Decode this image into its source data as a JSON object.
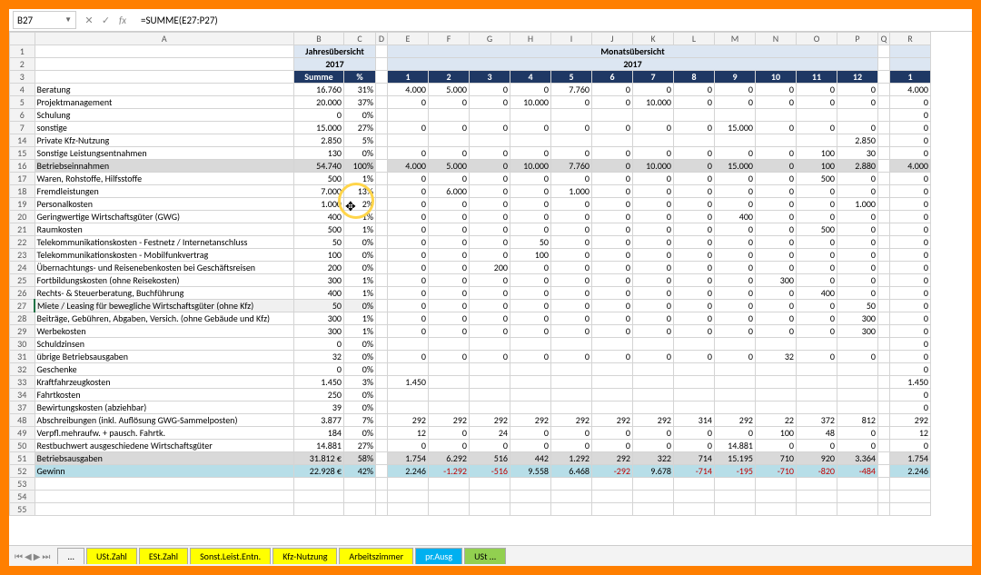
{
  "nameBox": "B27",
  "formula": "=SUMME(E27:P27)",
  "jahresHeader": "Jahresübersicht",
  "monatsHeader": "Monatsübersicht",
  "year": "2017",
  "sumLabel": "Summe",
  "pctLabel": "%",
  "colLetters": [
    "",
    "A",
    "B",
    "C",
    "D",
    "E",
    "F",
    "G",
    "H",
    "I",
    "J",
    "K",
    "L",
    "M",
    "N",
    "O",
    "P",
    "Q",
    "R"
  ],
  "months": [
    "1",
    "2",
    "3",
    "4",
    "5",
    "6",
    "7",
    "8",
    "9",
    "10",
    "11",
    "12"
  ],
  "rightStart": "1",
  "rows": [
    {
      "r": 4,
      "label": "Beratung",
      "b": "16.760",
      "c": "31%",
      "m": [
        "4.000",
        "5.000",
        "0",
        "0",
        "7.760",
        "0",
        "0",
        "0",
        "0",
        "0",
        "0",
        "0"
      ],
      "rr": "4.000"
    },
    {
      "r": 5,
      "label": "Projektmanagement",
      "b": "20.000",
      "c": "37%",
      "m": [
        "0",
        "0",
        "0",
        "10.000",
        "0",
        "0",
        "10.000",
        "0",
        "0",
        "0",
        "0",
        "0"
      ],
      "rr": "0"
    },
    {
      "r": 6,
      "label": "Schulung",
      "b": "0",
      "c": "0%",
      "m": [
        "",
        "",
        "",
        "",
        "",
        "",
        "",
        "",
        "",
        "",
        "",
        ""
      ],
      "rr": "0"
    },
    {
      "r": 7,
      "label": "sonstige",
      "b": "15.000",
      "c": "27%",
      "m": [
        "0",
        "0",
        "0",
        "0",
        "0",
        "0",
        "0",
        "0",
        "15.000",
        "0",
        "0",
        "0"
      ],
      "rr": "0"
    },
    {
      "r": 14,
      "label": "Private Kfz-Nutzung",
      "b": "2.850",
      "c": "5%",
      "m": [
        "",
        "",
        "",
        "",
        "",
        "",
        "",
        "",
        "",
        "",
        "",
        "2.850"
      ],
      "rr": "0"
    },
    {
      "r": 15,
      "label": "Sonstige Leistungsentnahmen",
      "b": "130",
      "c": "0%",
      "m": [
        "0",
        "0",
        "0",
        "0",
        "0",
        "0",
        "0",
        "0",
        "0",
        "0",
        "100",
        "30"
      ],
      "rr": "0"
    },
    {
      "r": 16,
      "label": "Betriebseinnahmen",
      "b": "54.740",
      "c": "100%",
      "m": [
        "4.000",
        "5.000",
        "0",
        "10.000",
        "7.760",
        "0",
        "10.000",
        "0",
        "15.000",
        "0",
        "100",
        "2.880"
      ],
      "rr": "4.000",
      "tot": true
    },
    {
      "r": 17,
      "label": "Waren, Rohstoffe, Hilfsstoffe",
      "b": "500",
      "c": "1%",
      "m": [
        "0",
        "0",
        "0",
        "0",
        "0",
        "0",
        "0",
        "0",
        "0",
        "0",
        "500",
        "0"
      ],
      "rr": "0"
    },
    {
      "r": 18,
      "label": "Fremdleistungen",
      "b": "7.000",
      "c": "13%",
      "m": [
        "0",
        "6.000",
        "0",
        "0",
        "1.000",
        "0",
        "0",
        "0",
        "0",
        "0",
        "0",
        "0"
      ],
      "rr": "0"
    },
    {
      "r": 19,
      "label": "Personalkosten",
      "b": "1.000",
      "c": "2%",
      "m": [
        "0",
        "0",
        "0",
        "0",
        "0",
        "0",
        "0",
        "0",
        "0",
        "0",
        "0",
        "1.000"
      ],
      "rr": "0"
    },
    {
      "r": 20,
      "label": "Geringwertige Wirtschaftsgüter (GWG)",
      "b": "400",
      "c": "1%",
      "m": [
        "0",
        "0",
        "0",
        "0",
        "0",
        "0",
        "0",
        "0",
        "400",
        "0",
        "0",
        "0"
      ],
      "rr": "0"
    },
    {
      "r": 21,
      "label": "Raumkosten",
      "b": "500",
      "c": "1%",
      "m": [
        "0",
        "0",
        "0",
        "0",
        "0",
        "0",
        "0",
        "0",
        "0",
        "0",
        "500",
        "0"
      ],
      "rr": "0"
    },
    {
      "r": 22,
      "label": "Telekommunikationskosten - Festnetz / Internetanschluss",
      "b": "50",
      "c": "0%",
      "m": [
        "0",
        "0",
        "0",
        "50",
        "0",
        "0",
        "0",
        "0",
        "0",
        "0",
        "0",
        "0"
      ],
      "rr": "0"
    },
    {
      "r": 23,
      "label": "Telekommunikationskosten - Mobilfunkvertrag",
      "b": "100",
      "c": "0%",
      "m": [
        "0",
        "0",
        "0",
        "100",
        "0",
        "0",
        "0",
        "0",
        "0",
        "0",
        "0",
        "0"
      ],
      "rr": "0"
    },
    {
      "r": 24,
      "label": "Übernachtungs- und Reisenebenkosten bei Geschäftsreisen",
      "b": "200",
      "c": "0%",
      "m": [
        "0",
        "0",
        "200",
        "0",
        "0",
        "0",
        "0",
        "0",
        "0",
        "0",
        "0",
        "0"
      ],
      "rr": "0"
    },
    {
      "r": 25,
      "label": "Fortbildungskosten (ohne Reisekosten)",
      "b": "300",
      "c": "1%",
      "m": [
        "0",
        "0",
        "0",
        "0",
        "0",
        "0",
        "0",
        "0",
        "0",
        "300",
        "0",
        "0"
      ],
      "rr": "0"
    },
    {
      "r": 26,
      "label": "Rechts- & Steuerberatung, Buchführung",
      "b": "400",
      "c": "1%",
      "m": [
        "0",
        "0",
        "0",
        "0",
        "0",
        "0",
        "0",
        "0",
        "0",
        "0",
        "400",
        "0"
      ],
      "rr": "0"
    },
    {
      "r": 27,
      "label": "Miete / Leasing für bewegliche Wirtschaftsgüter (ohne Kfz)",
      "b": "50",
      "c": "0%",
      "m": [
        "0",
        "0",
        "0",
        "0",
        "0",
        "0",
        "0",
        "0",
        "0",
        "0",
        "0",
        "50"
      ],
      "rr": "0",
      "sel": true
    },
    {
      "r": 28,
      "label": "Beiträge, Gebühren, Abgaben, Versich. (ohne Gebäude und Kfz)",
      "b": "300",
      "c": "1%",
      "m": [
        "0",
        "0",
        "0",
        "0",
        "0",
        "0",
        "0",
        "0",
        "0",
        "0",
        "0",
        "300"
      ],
      "rr": "0"
    },
    {
      "r": 29,
      "label": "Werbekosten",
      "b": "300",
      "c": "1%",
      "m": [
        "0",
        "0",
        "0",
        "0",
        "0",
        "0",
        "0",
        "0",
        "0",
        "0",
        "0",
        "300"
      ],
      "rr": "0"
    },
    {
      "r": 30,
      "label": "Schuldzinsen",
      "b": "0",
      "c": "0%",
      "m": [
        "",
        "",
        "",
        "",
        "",
        "",
        "",
        "",
        "",
        "",
        "",
        ""
      ],
      "rr": "0"
    },
    {
      "r": 31,
      "label": "übrige Betriebsausgaben",
      "b": "32",
      "c": "0%",
      "m": [
        "0",
        "0",
        "0",
        "0",
        "0",
        "0",
        "0",
        "0",
        "0",
        "32",
        "0",
        "0"
      ],
      "rr": "0"
    },
    {
      "r": 32,
      "label": "Geschenke",
      "b": "0",
      "c": "0%",
      "m": [
        "",
        "",
        "",
        "",
        "",
        "",
        "",
        "",
        "",
        "",
        "",
        ""
      ],
      "rr": "0"
    },
    {
      "r": 33,
      "label": "Kraftfahrzeugkosten",
      "b": "1.450",
      "c": "3%",
      "m": [
        "1.450",
        "",
        "",
        "",
        "",
        "",
        "",
        "",
        "",
        "",
        "",
        ""
      ],
      "rr": "1.450"
    },
    {
      "r": 34,
      "label": "Fahrtkosten",
      "b": "250",
      "c": "0%",
      "m": [
        "",
        "",
        "",
        "",
        "",
        "",
        "",
        "",
        "",
        "",
        "",
        ""
      ],
      "rr": "0"
    },
    {
      "r": 37,
      "label": "Bewirtungskosten (abziehbar)",
      "b": "39",
      "c": "0%",
      "m": [
        "",
        "",
        "",
        "",
        "",
        "",
        "",
        "",
        "",
        "",
        "",
        ""
      ],
      "rr": "0"
    },
    {
      "r": 48,
      "label": "Abschreibungen (inkl. Auflösung GWG-Sammelposten)",
      "b": "3.877",
      "c": "7%",
      "m": [
        "292",
        "292",
        "292",
        "292",
        "292",
        "292",
        "292",
        "314",
        "292",
        "22",
        "372",
        "812"
      ],
      "rr": "292"
    },
    {
      "r": 49,
      "label": "Verpfl.mehraufw. + pausch. Fahrtk.",
      "b": "184",
      "c": "0%",
      "m": [
        "12",
        "0",
        "24",
        "0",
        "0",
        "0",
        "0",
        "0",
        "0",
        "100",
        "48",
        "0"
      ],
      "rr": "12"
    },
    {
      "r": 50,
      "label": "Restbuchwert ausgeschiedene Wirtschaftsgüter",
      "b": "14.881",
      "c": "27%",
      "m": [
        "0",
        "0",
        "0",
        "0",
        "0",
        "0",
        "0",
        "0",
        "14.881",
        "0",
        "0",
        "0"
      ],
      "rr": "0"
    },
    {
      "r": 51,
      "label": "Betriebsausgaben",
      "b": "31.812 €",
      "c": "58%",
      "m": [
        "1.754",
        "6.292",
        "516",
        "442",
        "1.292",
        "292",
        "322",
        "714",
        "15.195",
        "710",
        "920",
        "3.364"
      ],
      "rr": "1.754",
      "tot": true
    },
    {
      "r": 52,
      "label": "Gewinn",
      "b": "22.928 €",
      "c": "42%",
      "m": [
        "2.246",
        "-1.292",
        "-516",
        "9.558",
        "6.468",
        "-292",
        "9.678",
        "-714",
        "-195",
        "-710",
        "-820",
        "-484"
      ],
      "rr": "2.246",
      "gewinn": true
    }
  ],
  "emptyRows": [
    53,
    54,
    55
  ],
  "tabs": [
    {
      "label": "...",
      "cls": ""
    },
    {
      "label": "USt.Zahl",
      "cls": "y"
    },
    {
      "label": "ESt.Zahl",
      "cls": "y"
    },
    {
      "label": "Sonst.Leist.Entn.",
      "cls": "y"
    },
    {
      "label": "Kfz-Nutzung",
      "cls": "y"
    },
    {
      "label": "Arbeitszimmer",
      "cls": "y"
    },
    {
      "label": "pr.Ausg",
      "cls": "b"
    },
    {
      "label": "USt ...",
      "cls": "g"
    }
  ]
}
